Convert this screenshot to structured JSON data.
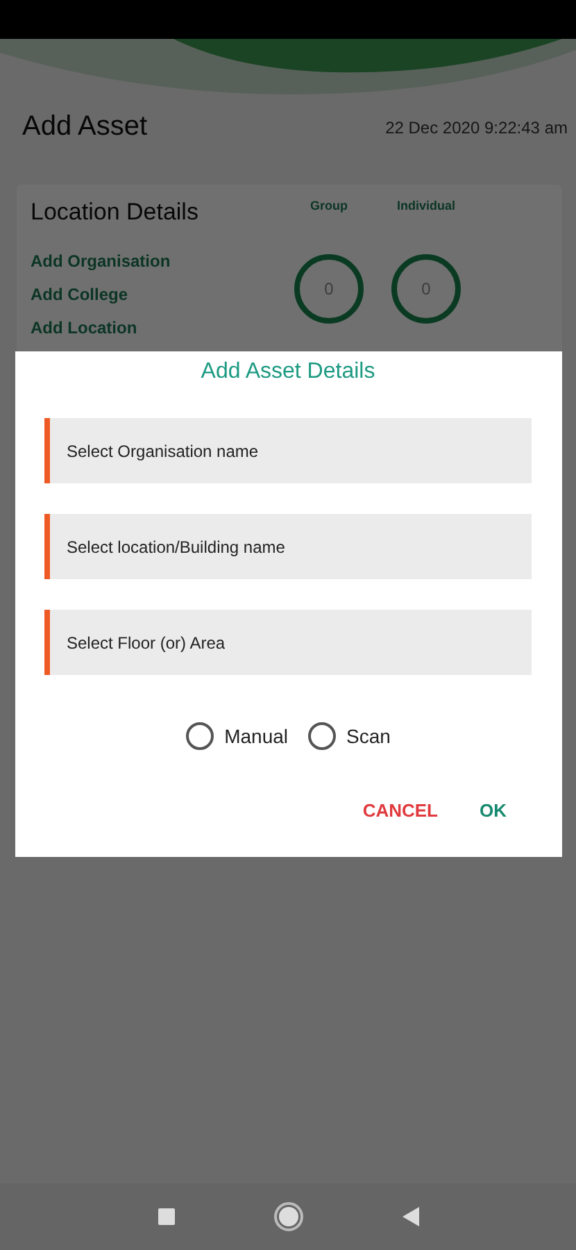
{
  "header": {
    "title": "Add Asset",
    "timestamp": "22 Dec 2020 9:22:43 am"
  },
  "location_card": {
    "title": "Location Details",
    "links": [
      "Add Organisation",
      "Add College",
      "Add Location"
    ],
    "counters": [
      {
        "label": "Group",
        "value": "0"
      },
      {
        "label": "Individual",
        "value": "0"
      }
    ]
  },
  "dialog": {
    "title": "Add Asset Details",
    "fields": [
      {
        "placeholder": "Select Organisation name"
      },
      {
        "placeholder": "Select location/Building name"
      },
      {
        "placeholder": "Select Floor (or) Area"
      }
    ],
    "modes": [
      {
        "label": "Manual",
        "selected": false
      },
      {
        "label": "Scan",
        "selected": false
      }
    ],
    "buttons": [
      {
        "label": "CANCEL",
        "kind": "negative"
      },
      {
        "label": "OK",
        "kind": "positive"
      }
    ]
  }
}
